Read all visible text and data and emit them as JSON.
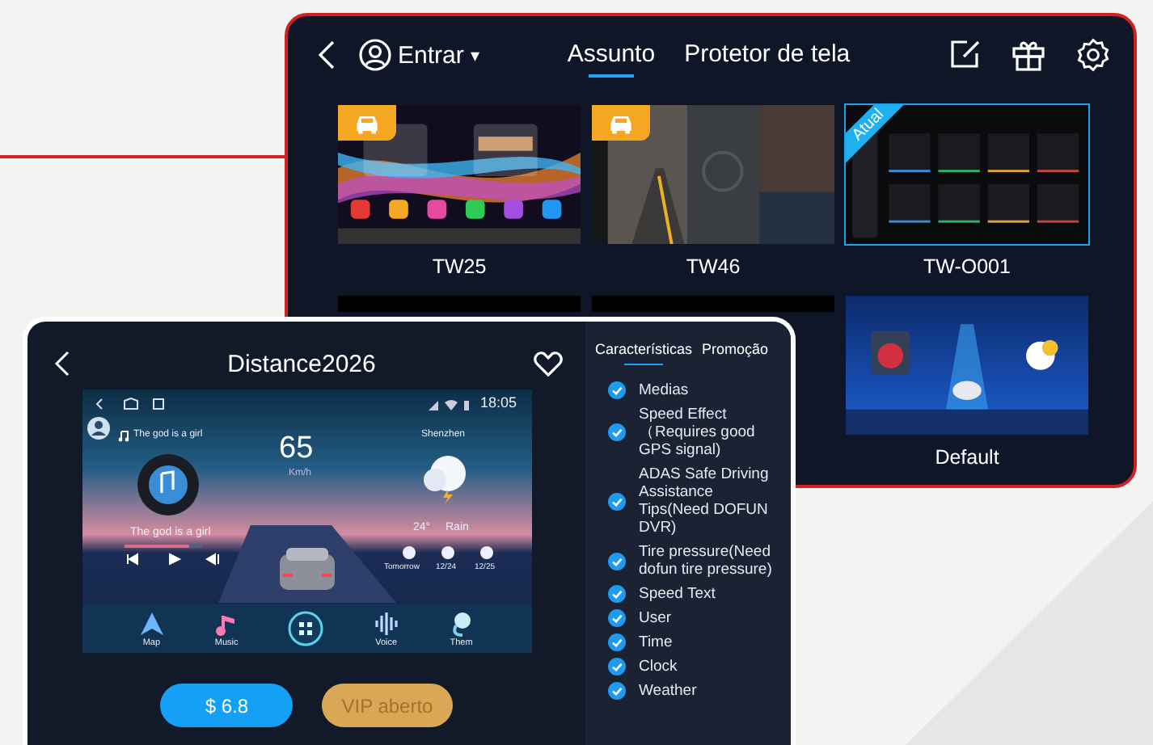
{
  "themes_window": {
    "account": {
      "label": "Entrar",
      "caret": "▾"
    },
    "tabs": [
      {
        "label": "Assunto",
        "selected": true
      },
      {
        "label": "Protetor de tela",
        "selected": false
      }
    ],
    "themes": [
      {
        "label": "TW25",
        "selected": false,
        "car_badge": true,
        "kind": "aurora"
      },
      {
        "label": "TW46",
        "selected": false,
        "car_badge": true,
        "kind": "road"
      },
      {
        "label": "TW-O001",
        "selected": true,
        "car_badge": false,
        "ribbon": "Atual",
        "kind": "grid"
      },
      {
        "selected": false,
        "car_badge": false,
        "kind": "strip"
      },
      {
        "selected": false,
        "car_badge": false,
        "kind": "strip"
      },
      {
        "label": "Default",
        "selected": false,
        "car_badge": false,
        "kind": "cockpit"
      }
    ]
  },
  "theme_detail": {
    "title": "Distance2026",
    "favorite": false,
    "preview": {
      "time": "18:05",
      "song": "The god is a girl",
      "song_caption": "The god is a girl",
      "song_progress": {
        "level": 0.85
      },
      "speed": "65",
      "speed_unit": "Km/h",
      "city": "Shenzhen",
      "temperature": "24°",
      "condition": "Rain",
      "forecast": [
        "Tomorrow",
        "12/24",
        "12/25"
      ],
      "dock": [
        {
          "kind": "map",
          "label": "Map"
        },
        {
          "kind": "music",
          "label": "Music"
        },
        {
          "kind": "home"
        },
        {
          "kind": "voice",
          "label": "Voice"
        },
        {
          "kind": "theme",
          "label": "Them"
        }
      ]
    },
    "price": "$ 6.8",
    "vip": "VIP aberto",
    "tabs": [
      {
        "label": "Características",
        "selected": true
      },
      {
        "label": "Promoção",
        "selected": false
      }
    ],
    "features": [
      {
        "label": "Medias",
        "checked": true
      },
      {
        "label": "Speed Effect（Requires good GPS signal)",
        "checked": true
      },
      {
        "label": "ADAS Safe Driving Assistance Tips(Need DOFUN DVR)",
        "checked": true
      },
      {
        "label": "Tire pressure(Need dofun tire pressure)",
        "checked": true
      },
      {
        "label": "Speed Text",
        "checked": true
      },
      {
        "label": "User",
        "checked": true
      },
      {
        "label": "Time",
        "checked": true
      },
      {
        "label": "Clock",
        "checked": true
      },
      {
        "label": "Weather",
        "checked": true
      }
    ]
  }
}
